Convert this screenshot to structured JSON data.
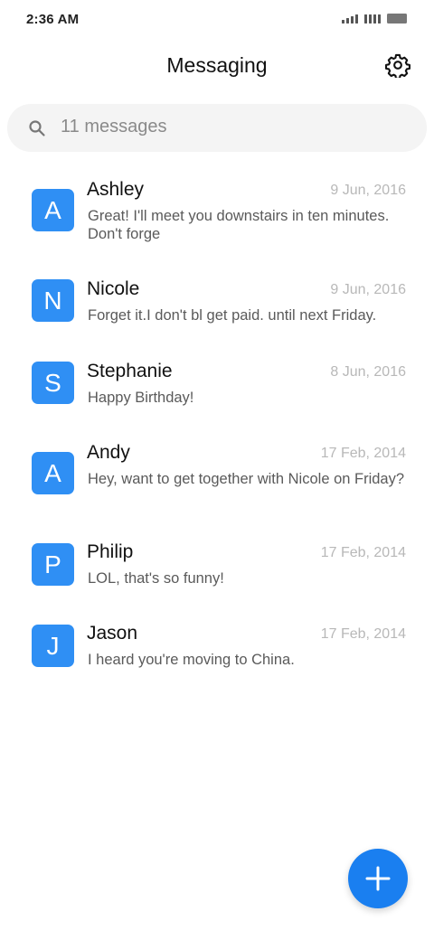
{
  "status_bar": {
    "time": "2:36 AM"
  },
  "header": {
    "title": "Messaging",
    "settings_icon": "gear-icon"
  },
  "search": {
    "icon": "search-icon",
    "placeholder": "11 messages"
  },
  "conversations": [
    {
      "initial": "A",
      "name": "Ashley",
      "date": "9 Jun, 2016",
      "preview": "Great! I'll meet you downstairs in ten minutes. Don't forge"
    },
    {
      "initial": "N",
      "name": "Nicole",
      "date": "9 Jun, 2016",
      "preview": "Forget it.I don't bl get paid. until next Friday."
    },
    {
      "initial": "S",
      "name": "Stephanie",
      "date": "8 Jun, 2016",
      "preview": "Happy Birthday!"
    },
    {
      "initial": "A",
      "name": "Andy",
      "date": "17 Feb, 2014",
      "preview": "Hey, want to get together with Nicole on Friday?"
    },
    {
      "initial": "P",
      "name": "Philip",
      "date": "17 Feb, 2014",
      "preview": "LOL, that's so funny!"
    },
    {
      "initial": "J",
      "name": "Jason",
      "date": "17 Feb, 2014",
      "preview": "I heard you're moving to China."
    }
  ],
  "fab": {
    "icon": "plus-icon"
  },
  "colors": {
    "accent": "#1a7ff0",
    "avatar": "#2f8ff4"
  }
}
